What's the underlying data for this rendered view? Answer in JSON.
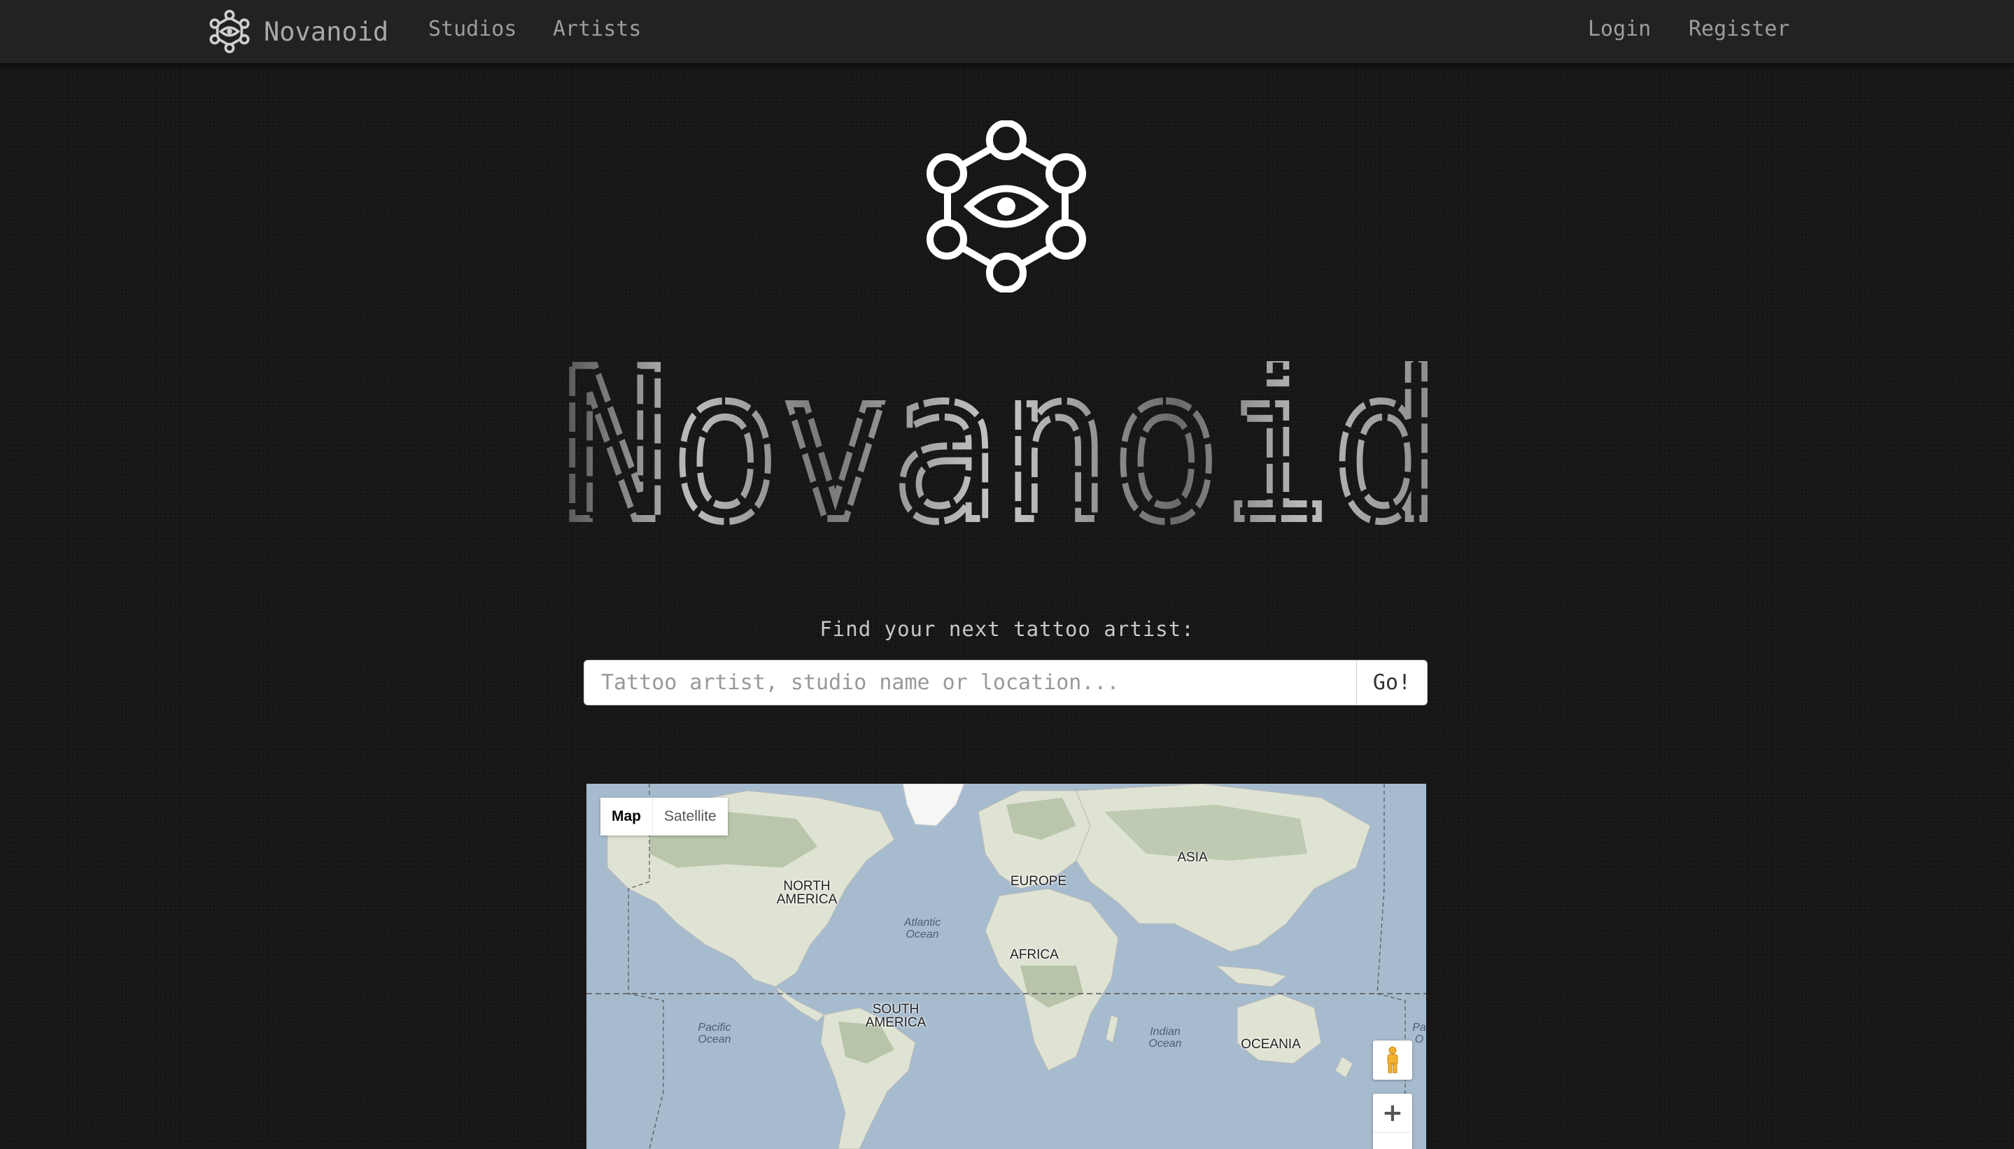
{
  "navbar": {
    "brand": "Novanoid",
    "links": {
      "studios": "Studios",
      "artists": "Artists",
      "login": "Login",
      "register": "Register"
    }
  },
  "hero": {
    "title": "Novanoid",
    "tagline": "Find your next tattoo artist:"
  },
  "search": {
    "placeholder": "Tattoo artist, studio name or location...",
    "value": "",
    "button_label": "Go!"
  },
  "map": {
    "type_map": "Map",
    "type_satellite": "Satellite",
    "zoom_in": "+",
    "continents": {
      "north_america": "NORTH\nAMERICA",
      "europe": "EUROPE",
      "asia": "ASIA",
      "africa": "AFRICA",
      "south_america": "SOUTH\nAMERICA",
      "oceania": "OCEANIA"
    },
    "oceans": {
      "atlantic": "Atlantic\nOcean",
      "pacific": "Pacific\nOcean",
      "indian": "Indian\nOcean",
      "pacific_right": "Pa\nO"
    },
    "colors": {
      "water": "#a6bbce",
      "land": "#dfe3d3",
      "forest": "#a9b99b",
      "snow": "#f6f6f4"
    }
  },
  "colors": {
    "background": "#171717",
    "navbar": "#222222",
    "nav_text": "#9d9d9d"
  }
}
